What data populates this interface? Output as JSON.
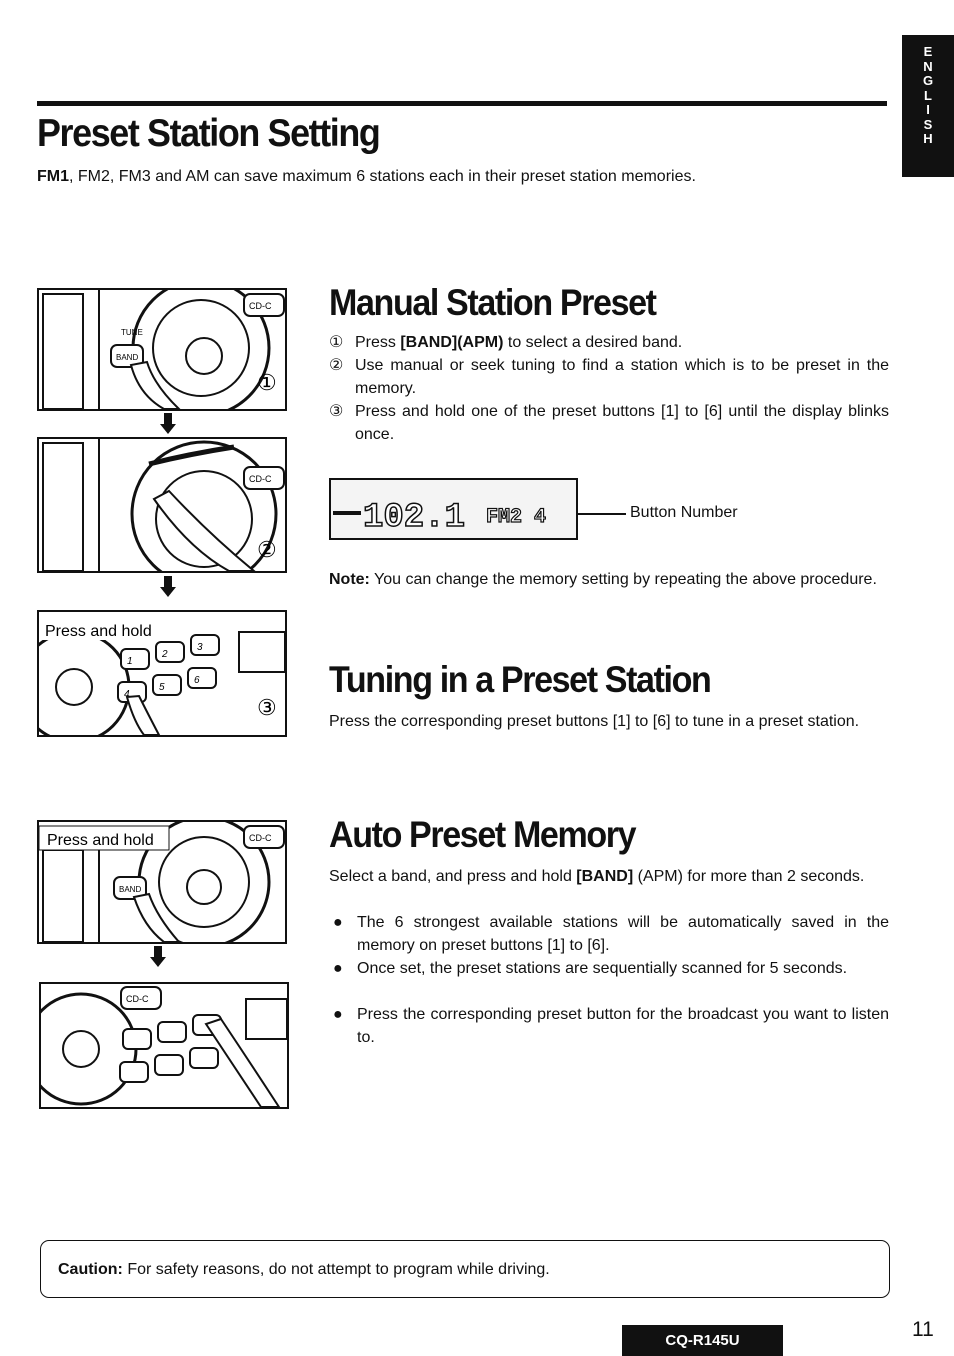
{
  "language_tab": [
    "E",
    "N",
    "G",
    "L",
    "I",
    "S",
    "H"
  ],
  "header": {
    "title": "Preset Station Setting",
    "intro_bold": "FM1",
    "intro_rest": ", FM2, FM3 and AM can save maximum 6 stations each in their preset station memories."
  },
  "illustrations": {
    "step1_marker": "①",
    "step2_marker": "②",
    "step3_marker": "③",
    "press_and_hold": "Press and hold",
    "cdc_label": "CD-C",
    "tune_label": "TUNE",
    "band_label": "BAND",
    "preset_buttons": [
      "1",
      "2",
      "3",
      "4",
      "5",
      "6"
    ]
  },
  "manual": {
    "title": "Manual Station Preset",
    "steps": [
      {
        "num": "①",
        "parts": [
          "Press ",
          "[BAND](APM)",
          " to select a desired band."
        ]
      },
      {
        "num": "②",
        "text": "Use manual or seek tuning to find a station which is to be preset in the memory."
      },
      {
        "num": "③",
        "text": "Press and hold one of the preset buttons [1] to [6] until the display blinks once."
      }
    ],
    "display_readout": "102.1",
    "display_band": "FM2",
    "display_preset": "4",
    "callout": "Button Number",
    "note_label": "Note:",
    "note_text": " You can change the memory setting by repeating the above procedure."
  },
  "tuning": {
    "title": "Tuning in a Preset Station",
    "text": "Press the corresponding preset buttons [1] to [6] to tune in a preset station."
  },
  "auto": {
    "title": "Auto Preset Memory",
    "intro_a": "Select a band, and press and hold ",
    "intro_bold": "[BAND]",
    "intro_b": " (APM) for more than 2 seconds.",
    "bullets": [
      "The 6 strongest available stations will be automatically saved in the memory on preset buttons [1] to [6].",
      "Once set, the preset stations are sequentially scanned for 5 seconds.",
      "Press the corresponding preset button for the broadcast you want to listen to."
    ]
  },
  "caution": {
    "label": "Caution:",
    "text": " For safety reasons, do not attempt to program while driving."
  },
  "footer": {
    "model": "CQ-R145U",
    "page": "11"
  }
}
